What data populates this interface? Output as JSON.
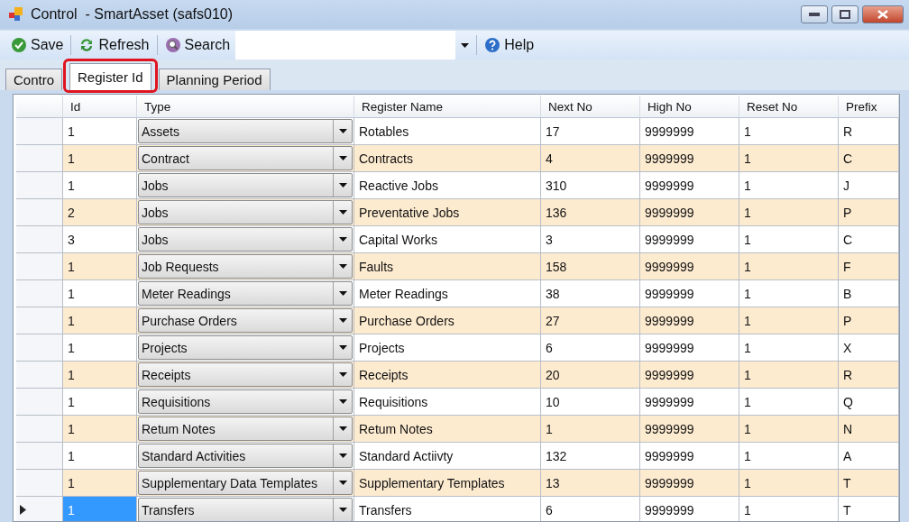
{
  "window": {
    "title": "Control  - SmartAsset (safs010)"
  },
  "toolbar": {
    "buttons": [
      {
        "kind": "save",
        "label": "Save"
      },
      {
        "kind": "refresh",
        "label": "Refresh"
      },
      {
        "kind": "search",
        "label": "Search"
      }
    ],
    "help": "Help"
  },
  "tabs": [
    {
      "label": "Contro",
      "selected": false
    },
    {
      "label": "Register Id",
      "selected": true
    },
    {
      "label": "Planning Period",
      "selected": false
    }
  ],
  "table": {
    "columns": [
      "Id",
      "Type",
      "Register Name",
      "Next No",
      "High No",
      "Reset No",
      "Prefix"
    ],
    "rows": [
      {
        "id": "1",
        "type": "Assets",
        "name": "Rotables",
        "next": "17",
        "high": "9999999",
        "reset": "1",
        "prefix": "R",
        "selected": false
      },
      {
        "id": "1",
        "type": "Contract",
        "name": "Contracts",
        "next": "4",
        "high": "9999999",
        "reset": "1",
        "prefix": "C",
        "selected": false
      },
      {
        "id": "1",
        "type": "Jobs",
        "name": "Reactive Jobs",
        "next": "310",
        "high": "9999999",
        "reset": "1",
        "prefix": "J",
        "selected": false
      },
      {
        "id": "2",
        "type": "Jobs",
        "name": "Preventative Jobs",
        "next": "136",
        "high": "9999999",
        "reset": "1",
        "prefix": "P",
        "selected": false
      },
      {
        "id": "3",
        "type": "Jobs",
        "name": "Capital Works",
        "next": "3",
        "high": "9999999",
        "reset": "1",
        "prefix": "C",
        "selected": false
      },
      {
        "id": "1",
        "type": "Job Requests",
        "name": "Faults",
        "next": "158",
        "high": "9999999",
        "reset": "1",
        "prefix": "F",
        "selected": false
      },
      {
        "id": "1",
        "type": "Meter Readings",
        "name": "Meter Readings",
        "next": "38",
        "high": "9999999",
        "reset": "1",
        "prefix": "B",
        "selected": false
      },
      {
        "id": "1",
        "type": "Purchase Orders",
        "name": "Purchase Orders",
        "next": "27",
        "high": "9999999",
        "reset": "1",
        "prefix": "P",
        "selected": false
      },
      {
        "id": "1",
        "type": "Projects",
        "name": "Projects",
        "next": "6",
        "high": "9999999",
        "reset": "1",
        "prefix": "X",
        "selected": false
      },
      {
        "id": "1",
        "type": "Receipts",
        "name": "Receipts",
        "next": "20",
        "high": "9999999",
        "reset": "1",
        "prefix": "R",
        "selected": false
      },
      {
        "id": "1",
        "type": "Requisitions",
        "name": "Requisitions",
        "next": "10",
        "high": "9999999",
        "reset": "1",
        "prefix": "Q",
        "selected": false
      },
      {
        "id": "1",
        "type": "Retum Notes",
        "name": "Retum Notes",
        "next": "1",
        "high": "9999999",
        "reset": "1",
        "prefix": "N",
        "selected": false
      },
      {
        "id": "1",
        "type": "Standard Activities",
        "name": "Standard Actiivty",
        "next": "132",
        "high": "9999999",
        "reset": "1",
        "prefix": "A",
        "selected": false
      },
      {
        "id": "1",
        "type": "Supplementary Data Templates",
        "name": "Supplementary Templates",
        "next": "13",
        "high": "9999999",
        "reset": "1",
        "prefix": "T",
        "selected": false
      },
      {
        "id": "1",
        "type": "Transfers",
        "name": "Transfers",
        "next": "6",
        "high": "9999999",
        "reset": "1",
        "prefix": "T",
        "selected": true
      }
    ]
  }
}
